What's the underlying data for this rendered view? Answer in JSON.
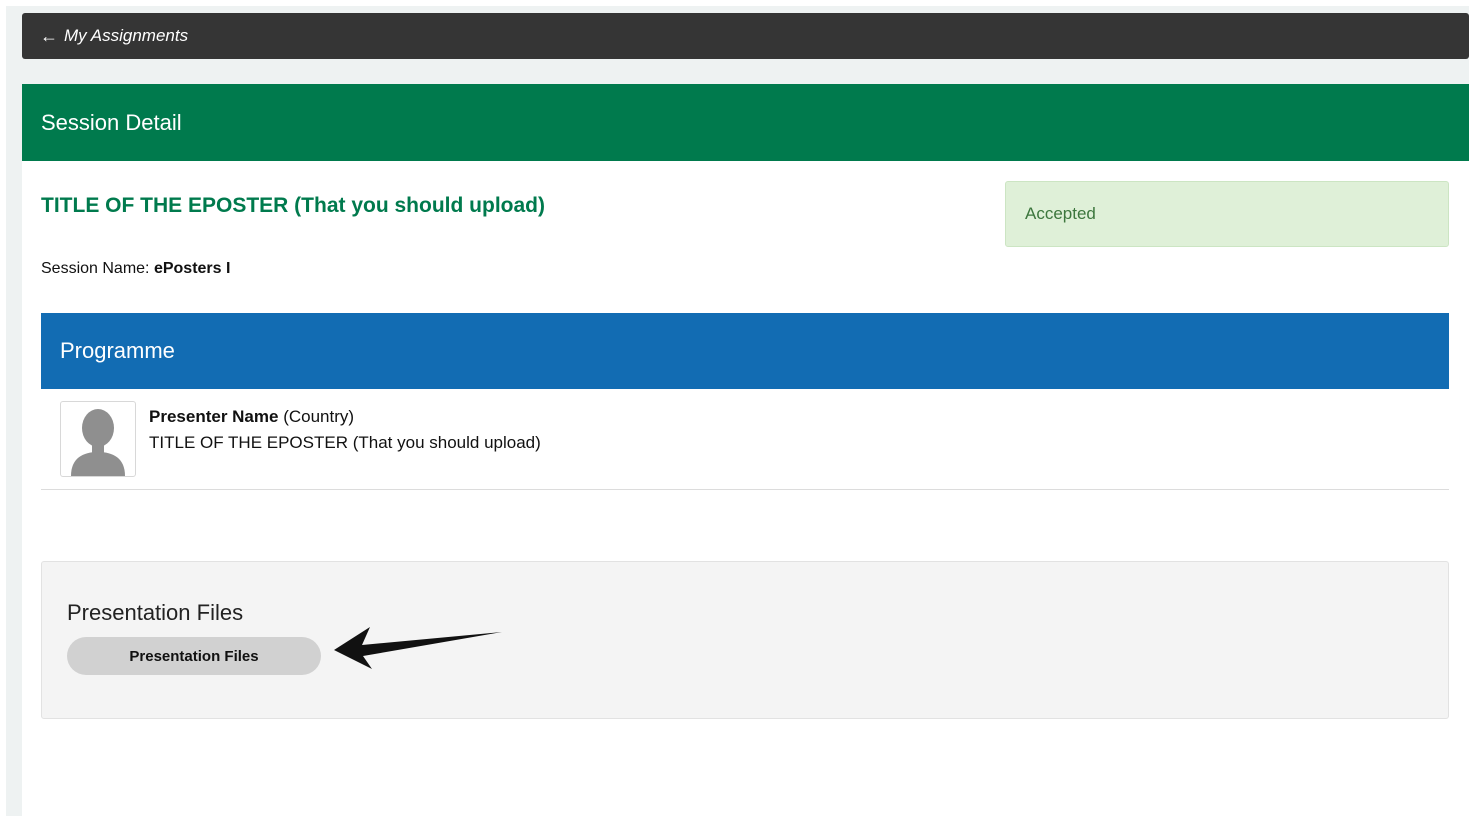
{
  "nav": {
    "back_arrow": "←",
    "back_label": "My Assignments"
  },
  "card": {
    "header": "Session Detail"
  },
  "poster": {
    "title": "TITLE OF THE EPOSTER (That you should upload)"
  },
  "status": {
    "label": "Accepted",
    "color": "#3c763d"
  },
  "session": {
    "name_label": "Session Name:",
    "name_value": "ePosters I"
  },
  "programme": {
    "header": "Programme",
    "presenter": {
      "name": "Presenter Name",
      "country": "(Country)",
      "title": "TITLE OF THE EPOSTER (That you should upload)",
      "avatar_icon": "person-silhouette-icon"
    }
  },
  "files": {
    "title": "Presentation Files",
    "button_label": "Presentation Files"
  },
  "annotation": {
    "icon": "arrow-left-icon"
  },
  "colors": {
    "header_green": "#007a4d",
    "programme_blue": "#126cb3",
    "topbar": "#353535"
  }
}
